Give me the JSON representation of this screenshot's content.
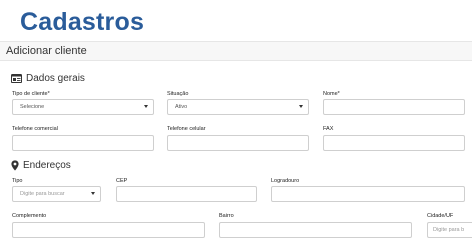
{
  "page": {
    "title": "Cadastros"
  },
  "card": {
    "title": "Adicionar cliente"
  },
  "dados_gerais": {
    "title": "Dados gerais",
    "tipo_cliente": {
      "label": "Tipo de cliente*",
      "value": "Selecione"
    },
    "situacao": {
      "label": "Situação",
      "value": "Ativo"
    },
    "nome": {
      "label": "Nome*",
      "value": ""
    },
    "telefone_comercial": {
      "label": "Telefone comercial",
      "value": ""
    },
    "telefone_celular": {
      "label": "Telefone celular",
      "value": ""
    },
    "fax": {
      "label": "FAX",
      "value": ""
    }
  },
  "enderecos": {
    "title": "Endereços",
    "tipo": {
      "label": "Tipo",
      "placeholder": "Digite para buscar"
    },
    "cep": {
      "label": "CEP",
      "value": ""
    },
    "logradouro": {
      "label": "Logradouro",
      "value": ""
    },
    "complemento": {
      "label": "Complemento",
      "value": ""
    },
    "bairro": {
      "label": "Bairro",
      "value": ""
    },
    "cidade_uf": {
      "label": "Cidade/UF",
      "placeholder": "Digite para b"
    }
  },
  "colors": {
    "title": "#2a5c9a",
    "border": "#cfcfcf",
    "header_bg": "#f7f7f7"
  }
}
